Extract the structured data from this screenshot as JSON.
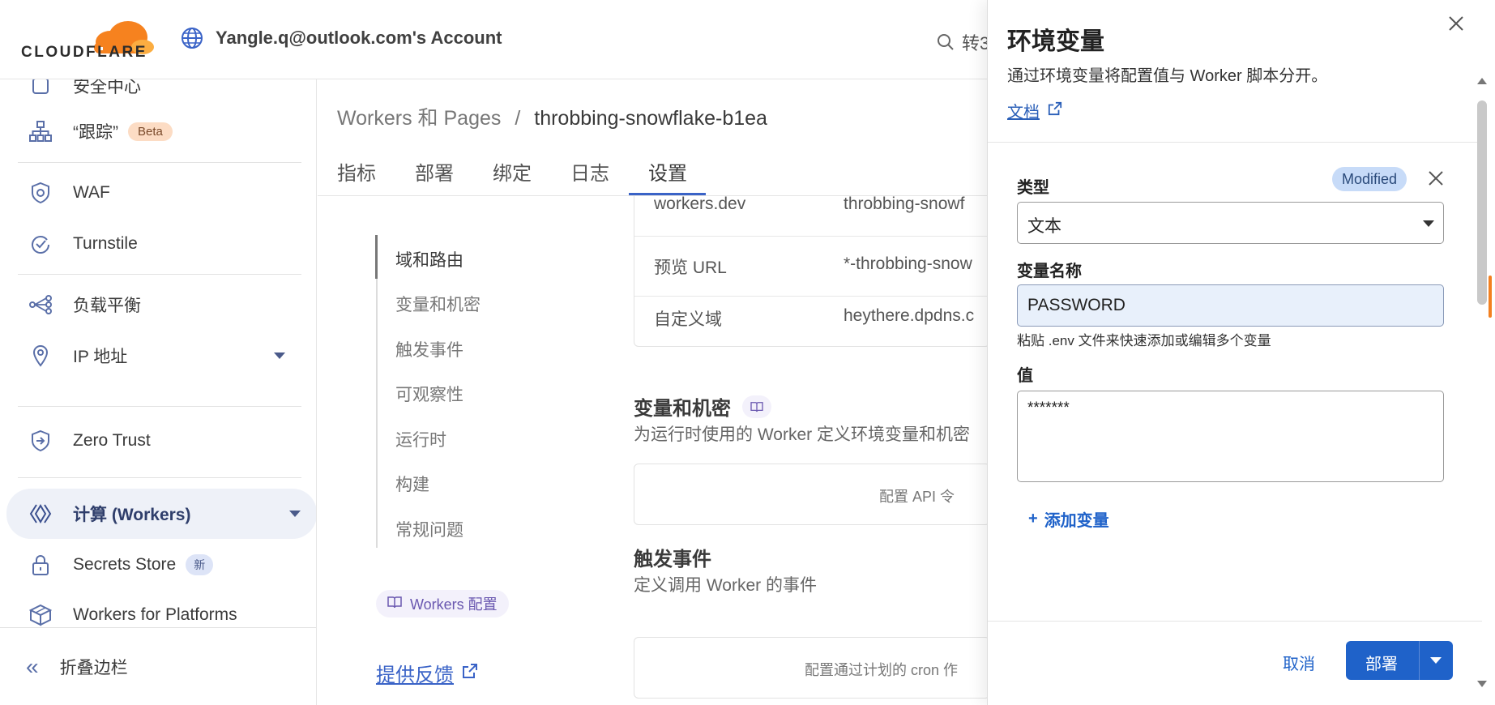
{
  "header": {
    "brand": "CLOUDFLARE",
    "account": "Yangle.q@outlook.com's Account",
    "search_partial": "转3"
  },
  "sidebar": {
    "items": [
      {
        "label": "安全中心"
      },
      {
        "label": "“跟踪”",
        "badge": "Beta"
      },
      {
        "label": "WAF"
      },
      {
        "label": "Turnstile"
      },
      {
        "label": "负载平衡"
      },
      {
        "label": "IP 地址"
      },
      {
        "label": "Zero Trust"
      },
      {
        "label": "计算 (Workers)"
      },
      {
        "label": "Secrets Store",
        "badge": "新"
      },
      {
        "label": "Workers for Platforms"
      }
    ],
    "collapse_label": "折叠边栏"
  },
  "main": {
    "breadcrumb": {
      "root": "Workers 和 Pages",
      "sep": "/",
      "current": "throbbing-snowflake-b1ea"
    },
    "tabs": [
      {
        "label": "指标"
      },
      {
        "label": "部署"
      },
      {
        "label": "绑定"
      },
      {
        "label": "日志"
      },
      {
        "label": "设置"
      }
    ],
    "subnav": [
      {
        "label": "域和路由"
      },
      {
        "label": "变量和机密"
      },
      {
        "label": "触发事件"
      },
      {
        "label": "可观察性"
      },
      {
        "label": "运行时"
      },
      {
        "label": "构建"
      },
      {
        "label": "常规问题"
      }
    ],
    "workers_chip": "Workers 配置",
    "feedback": "提供反馈",
    "domains": [
      {
        "key": "workers.dev",
        "value": "throbbing-snowf"
      },
      {
        "key": "预览 URL",
        "value": "*-throbbing-snow"
      },
      {
        "key": "自定义域",
        "value": "heythere.dpdns.c"
      }
    ],
    "vars_section": {
      "title": "变量和机密",
      "subtitle": "为运行时使用的 Worker 定义环境变量和机密",
      "box_text": "配置 API 令"
    },
    "triggers_section": {
      "title": "触发事件",
      "subtitle": "定义调用 Worker 的事件",
      "box_text": "配置通过计划的 cron 作"
    }
  },
  "panel": {
    "title": "环境变量",
    "description": "通过环境变量将配置值与 Worker 脚本分开。",
    "doc_link": "文档",
    "type_label": "类型",
    "modified_badge": "Modified",
    "type_value": "文本",
    "name_label": "变量名称",
    "name_value": "PASSWORD",
    "hint": "粘贴 .env 文件来快速添加或编辑多个变量",
    "value_label": "值",
    "value_value": "*******",
    "add_variable": "添加变量",
    "cancel": "取消",
    "deploy": "部署"
  },
  "colors": {
    "accent": "#1f62c9",
    "brand_orange": "#f38020",
    "modified_badge": "#c7dbf8"
  }
}
